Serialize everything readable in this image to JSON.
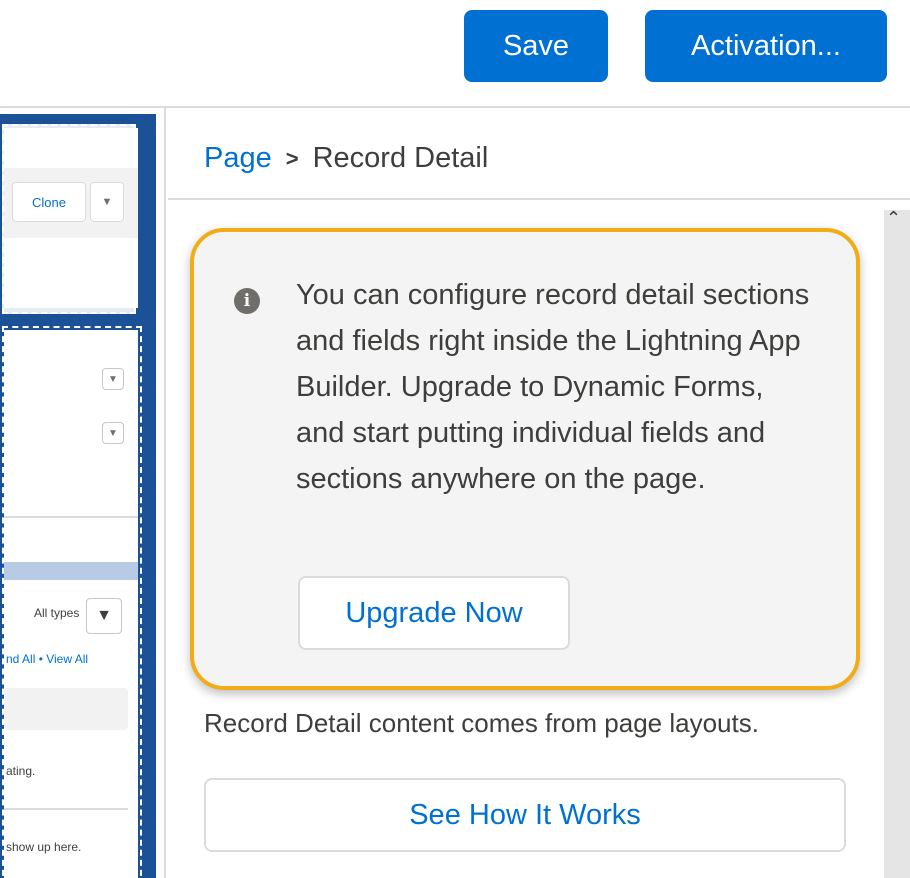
{
  "toolbar": {
    "save_label": "Save",
    "activation_label": "Activation..."
  },
  "canvas": {
    "clone_label": "Clone",
    "filter_label": "All types",
    "links": "nd All • View All",
    "text_1": "ating.",
    "text_2": "show up here."
  },
  "panel": {
    "breadcrumb": {
      "parent": "Page",
      "separator": ">",
      "current": "Record Detail"
    },
    "callout": {
      "icon": "info-icon",
      "message": "You can configure record detail sections and fields right inside the Lightning App Builder. Upgrade to Dynamic Forms, and start putting individual fields and sections anywhere on the page.",
      "button_label": "Upgrade Now",
      "highlight_color": "#f0ad17"
    },
    "description": "Record Detail content comes from page layouts.",
    "how_button_label": "See How It Works"
  },
  "colors": {
    "brand": "#0070d2",
    "canvas_background": "#1b5297"
  }
}
